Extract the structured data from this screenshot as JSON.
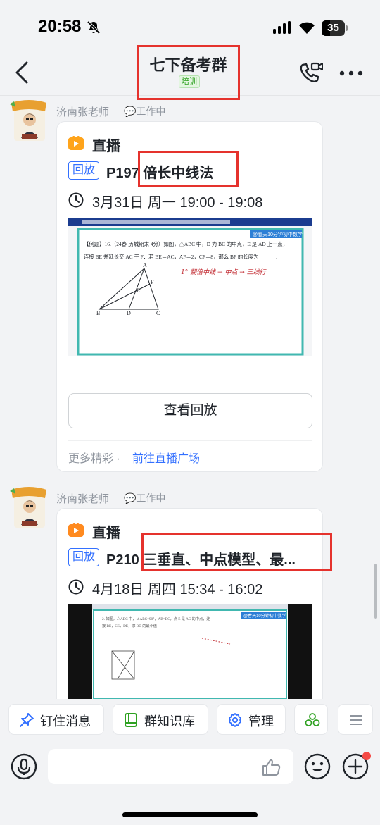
{
  "status_bar": {
    "time": "20:58",
    "battery": "35"
  },
  "header": {
    "title": "七下备考群",
    "tag": "培训"
  },
  "messages": [
    {
      "sender": "济南张老师",
      "status": "💬工作中",
      "card": {
        "kind": "直播",
        "replay_tag": "回放",
        "title": "P197 倍长中线法",
        "time_range": "3月31日 周一 19:00 - 19:08",
        "button": "查看回放",
        "more_text": "更多精彩 ·",
        "more_link": "前往直播广场",
        "thumbnail": {
          "brand": "@春天10分钟初中数学",
          "problem_line1": "【例题】16.（24春·历城期末 4分）如图，△ABC 中，D 为 BC 的中点，E 是 AD 上一点，",
          "problem_line2": "连接 BE 并延长交 AC 于 F．若 BE＝AC，AF＝2，CF＝8，那么 BF 的长度为 ＿＿＿．",
          "note": "1° 翻倍中线 → 中点 → 三线行",
          "labels": [
            "A",
            "F",
            "E",
            "B",
            "D",
            "C"
          ]
        }
      }
    },
    {
      "sender": "济南张老师",
      "status": "💬工作中",
      "card": {
        "kind": "直播",
        "replay_tag": "回放",
        "title": "P210 三垂直、中点模型、最...",
        "time_range": "4月18日 周四 15:34 - 16:02",
        "thumbnail": {
          "brand": "@春天10分钟初中数学",
          "problem_line1": "2. 如图，△ABC 中，∠ABC=90°，AB=BC，点 E 是 AC 的中点，连",
          "problem_line2": "接 BE，CE，DE，求 BD 的最小值"
        }
      }
    }
  ],
  "quick_actions": [
    {
      "label": "钉住消息",
      "icon": "pin-icon"
    },
    {
      "label": "群知识库",
      "icon": "knowledge-base-icon"
    },
    {
      "label": "管理",
      "icon": "settings-icon"
    }
  ],
  "input": {
    "placeholder": ""
  },
  "colors": {
    "accent": "#3370ff",
    "highlight": "#e5322d",
    "tag_green": "#2ea121"
  }
}
